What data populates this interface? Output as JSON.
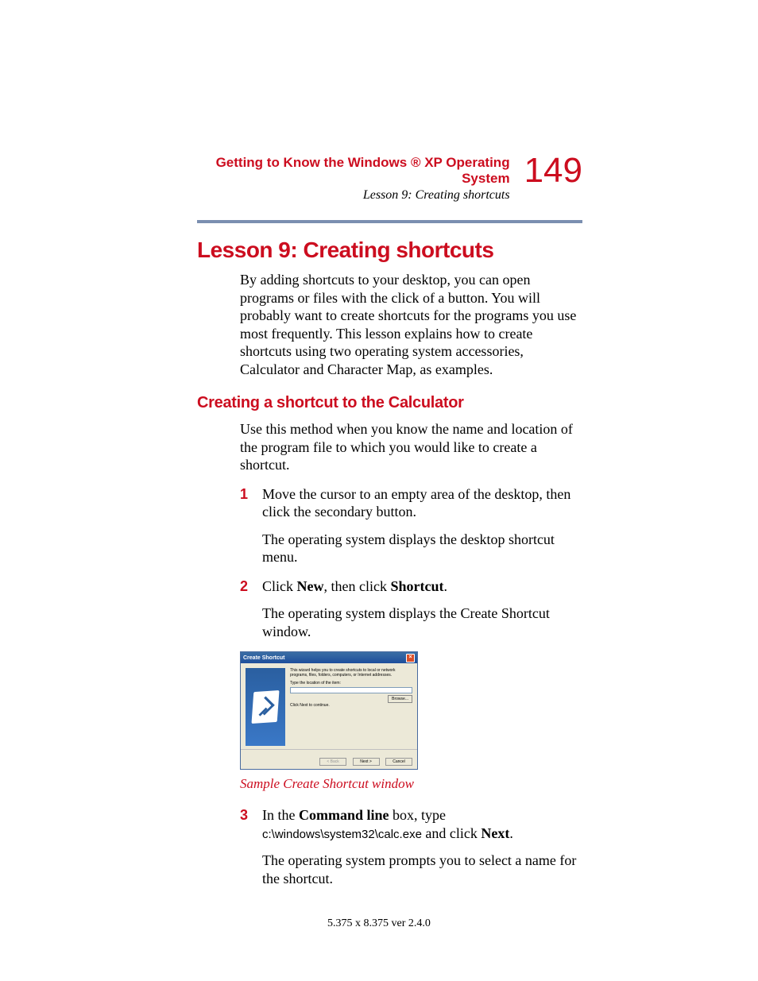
{
  "header": {
    "running_title": "Getting to Know the Windows ® XP Operating System",
    "running_sub": "Lesson 9: Creating shortcuts",
    "page_number": "149"
  },
  "h1": "Lesson 9: Creating shortcuts",
  "intro": "By adding shortcuts to your desktop, you can open programs or files with the click of a button. You will probably want to create shortcuts for the programs you use most frequently. This lesson explains how to create shortcuts using two operating system accessories, Calculator and Character Map, as examples.",
  "h2": "Creating a shortcut to the Calculator",
  "p2": "Use this method when you know the name and location of the program file to which you would like to create a shortcut.",
  "steps": {
    "s1num": "1",
    "s1": "Move the cursor to an empty area of the desktop, then click the secondary button.",
    "s1sub": "The operating system displays the desktop shortcut menu.",
    "s2num": "2",
    "s2a": "Click ",
    "s2b": "New",
    "s2c": ", then click ",
    "s2d": "Shortcut",
    "s2e": ".",
    "s2sub": "The operating system displays the Create Shortcut window.",
    "s3num": "3",
    "s3a": "In the ",
    "s3b": "Command line",
    "s3c": " box, type ",
    "s3d": "c:\\windows\\system32\\calc.exe",
    "s3e": " and click ",
    "s3f": "Next",
    "s3g": ".",
    "s3sub": "The operating system prompts you to select a name for the shortcut."
  },
  "dialog": {
    "title": "Create Shortcut",
    "desc": "This wizard helps you to create shortcuts to local or network programs, files, folders, computers, or Internet addresses.",
    "label": "Type the location of the item:",
    "browse": "Browse...",
    "hint": "Click Next to continue.",
    "back": "< Back",
    "next": "Next >",
    "cancel": "Cancel"
  },
  "caption": "Sample Create Shortcut window",
  "footer": "5.375 x 8.375 ver 2.4.0"
}
